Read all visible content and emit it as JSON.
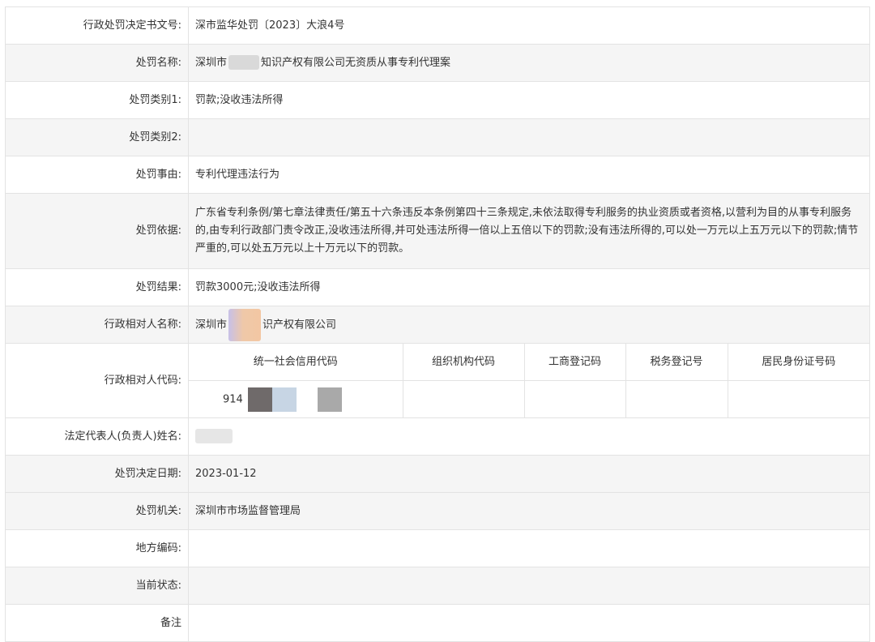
{
  "rows": {
    "decision_no": {
      "label": "行政处罚决定书文号:",
      "value": "深市监华处罚〔2023〕大浪4号"
    },
    "case_name": {
      "label": "处罚名称:",
      "value_prefix": "深圳市",
      "value_suffix": "知识产权有限公司无资质从事专利代理案"
    },
    "category1": {
      "label": "处罚类别1:",
      "value": "罚款;没收违法所得"
    },
    "category2": {
      "label": "处罚类别2:",
      "value": ""
    },
    "reason": {
      "label": "处罚事由:",
      "value": "专利代理违法行为"
    },
    "basis": {
      "label": "处罚依据:",
      "value": "广东省专利条例/第七章法律责任/第五十六条违反本条例第四十三条规定,未依法取得专利服务的执业资质或者资格,以营利为目的从事专利服务的,由专利行政部门责令改正,没收违法所得,并可处违法所得一倍以上五倍以下的罚款;没有违法所得的,可以处一万元以上五万元以下的罚款;情节严重的,可以处五万元以上十万元以下的罚款。"
    },
    "result": {
      "label": "处罚结果:",
      "value": "罚款3000元;没收违法所得"
    },
    "party_name": {
      "label": "行政相对人名称:",
      "value_prefix": "深圳市",
      "value_suffix": "识产权有限公司"
    },
    "party_code": {
      "label": "行政相对人代码:",
      "headers": [
        "统一社会信用代码",
        "组织机构代码",
        "工商登记码",
        "税务登记号",
        "居民身份证号码"
      ],
      "credit_code_visible": "914"
    },
    "legal_rep": {
      "label": "法定代表人(负责人)姓名:",
      "value": ""
    },
    "decision_date": {
      "label": "处罚决定日期:",
      "value": "2023-01-12"
    },
    "authority": {
      "label": "处罚机关:",
      "value": "深圳市市场监督管理局"
    },
    "local_code": {
      "label": "地方编码:",
      "value": ""
    },
    "status": {
      "label": "当前状态:",
      "value": ""
    },
    "remark": {
      "label": "备注",
      "value": ""
    }
  }
}
